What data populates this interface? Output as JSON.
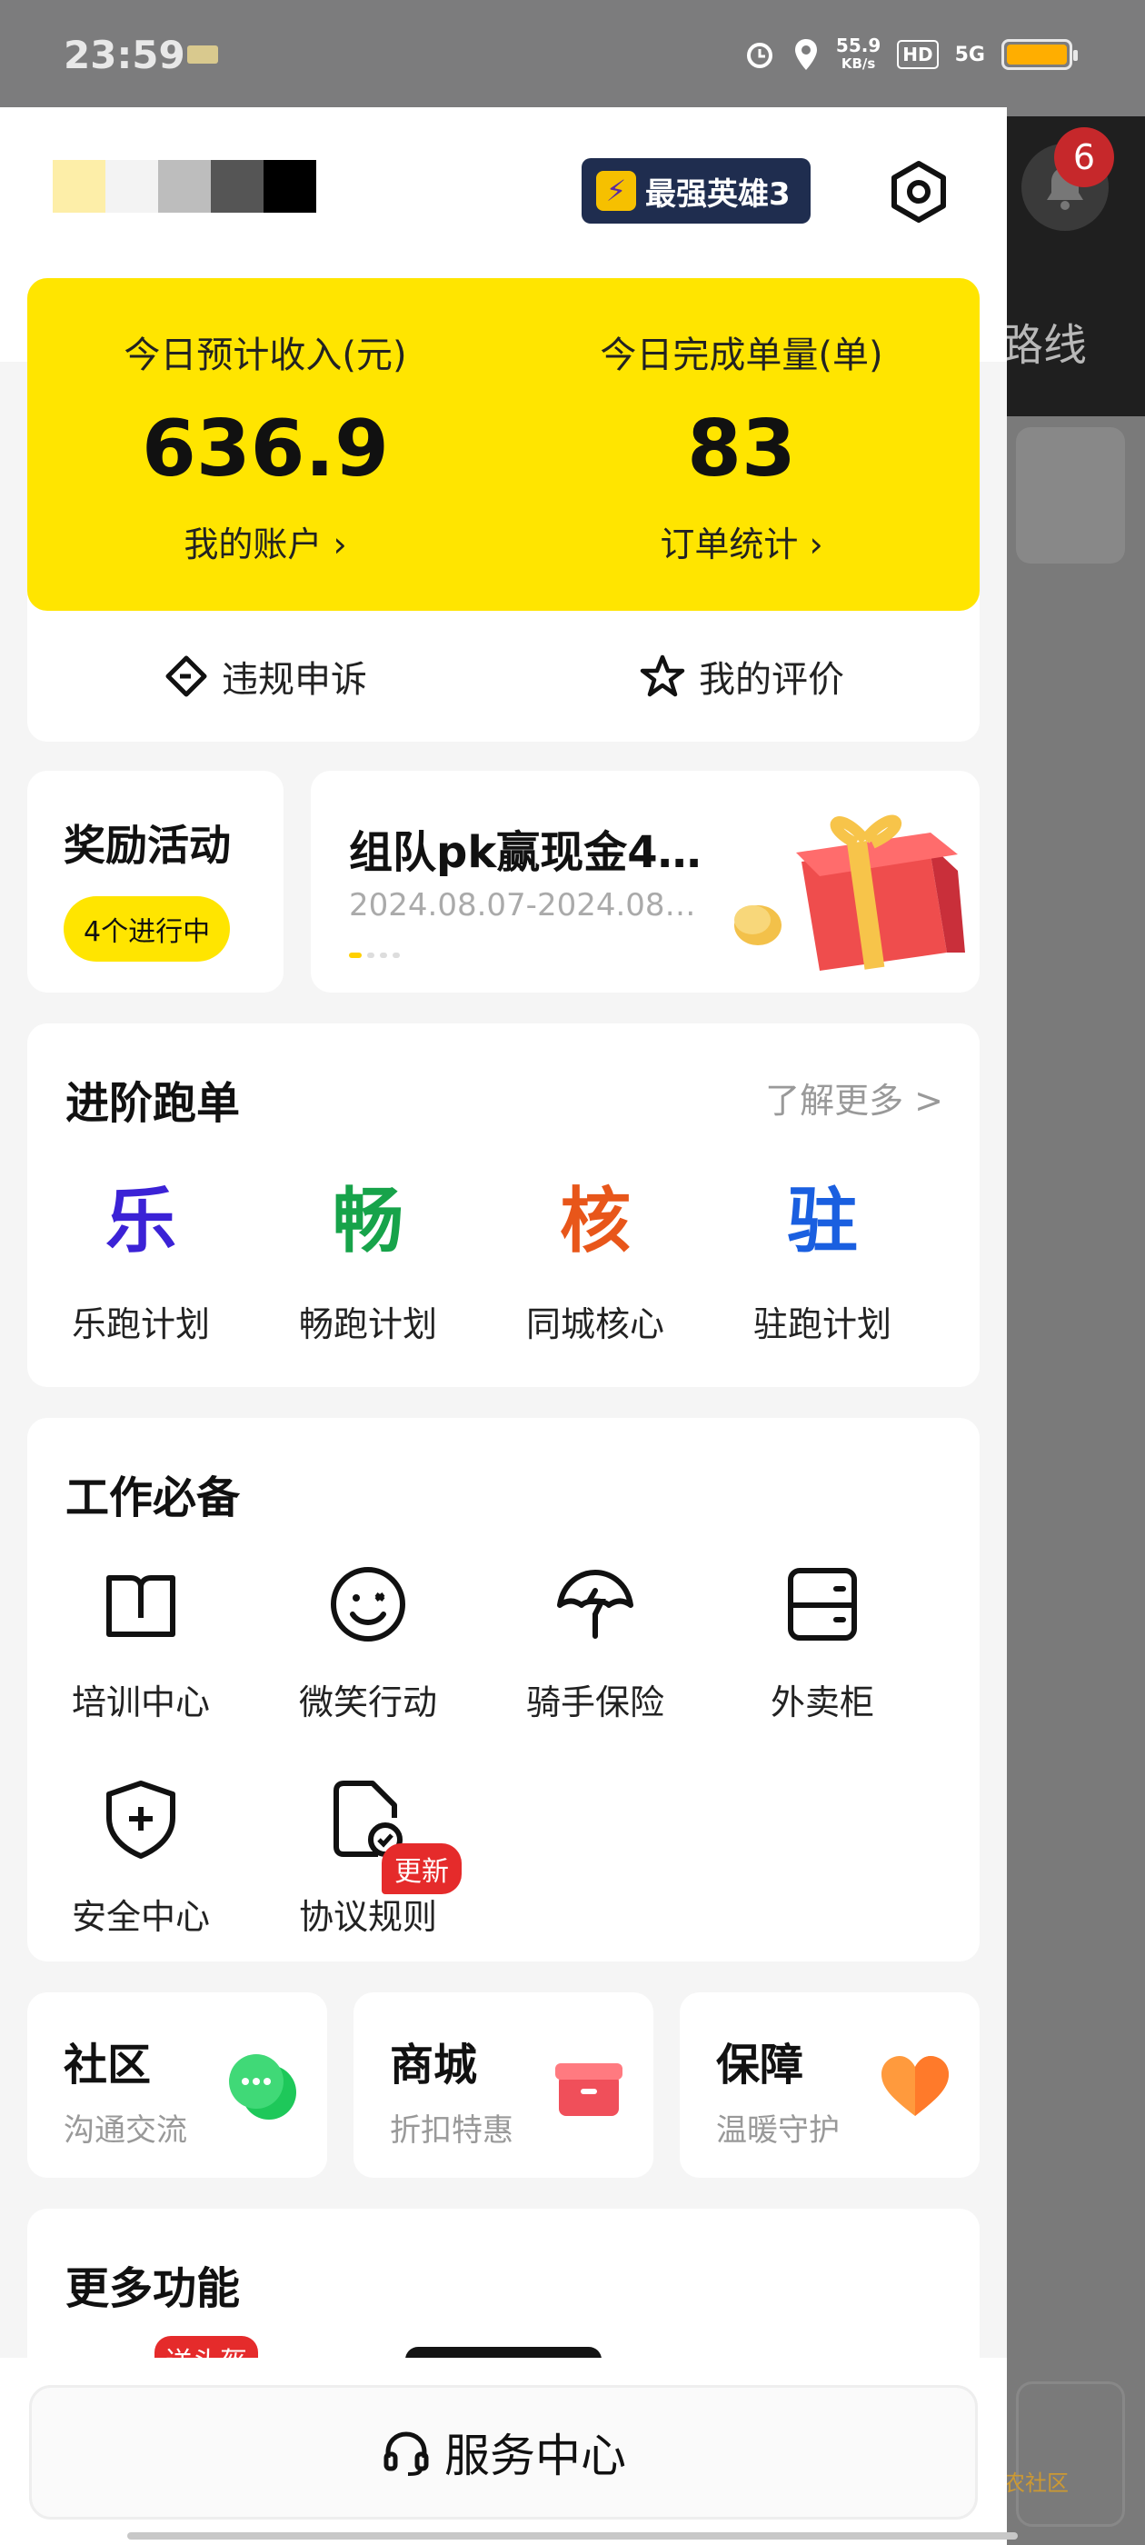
{
  "status_bar": {
    "time": "23:59",
    "speed_value": "55.9",
    "speed_unit": "KB/s",
    "hd": "HD",
    "signal": "5G"
  },
  "background": {
    "notification_count": "6",
    "route_text": "路线"
  },
  "header": {
    "hero_badge": "最强英雄3"
  },
  "income": {
    "left_label": "今日预计收入(元)",
    "left_value": "636.9",
    "left_link": "我的账户 ›",
    "right_label": "今日完成单量(单)",
    "right_value": "83",
    "right_link": "订单统计 ›",
    "appeal": "违规申诉",
    "rating": "我的评价"
  },
  "reward": {
    "title": "奖励活动",
    "pill": "4个进行中"
  },
  "promo": {
    "title": "组队pk赢现金4…",
    "date": "2024.08.07-2024.08…"
  },
  "advanced": {
    "title": "进阶跑单",
    "more": "了解更多 >",
    "items": [
      {
        "glyph": "乐",
        "label": "乐跑计划",
        "color": "#3b22d6"
      },
      {
        "glyph": "畅",
        "label": "畅跑计划",
        "color": "#17a34a"
      },
      {
        "glyph": "核",
        "label": "同城核心",
        "color": "#e8561a"
      },
      {
        "glyph": "驻",
        "label": "驻跑计划",
        "color": "#1a5fe0"
      }
    ]
  },
  "tools": {
    "title": "工作必备",
    "items": [
      {
        "label": "培训中心",
        "icon": "book-icon"
      },
      {
        "label": "微笑行动",
        "icon": "smile-icon"
      },
      {
        "label": "骑手保险",
        "icon": "umbrella-icon"
      },
      {
        "label": "外卖柜",
        "icon": "locker-icon"
      },
      {
        "label": "安全中心",
        "icon": "shield-icon"
      },
      {
        "label": "协议规则",
        "icon": "agreement-icon"
      }
    ],
    "new_badge": "更新"
  },
  "mini_cards": [
    {
      "title": "社区",
      "sub": "沟通交流",
      "icon": "chat-icon"
    },
    {
      "title": "商城",
      "sub": "折扣特惠",
      "icon": "shop-icon"
    },
    {
      "title": "保障",
      "sub": "温暖守护",
      "icon": "heart-icon"
    }
  ],
  "more_functions": {
    "title": "更多功能",
    "hot_badge": "送头盔"
  },
  "tooltip": "更新",
  "service": {
    "label": "服务中心"
  },
  "watermark": "卡农社区",
  "colors": {
    "accent_yellow": "#ffe500",
    "badge_red": "#e52b2b"
  }
}
